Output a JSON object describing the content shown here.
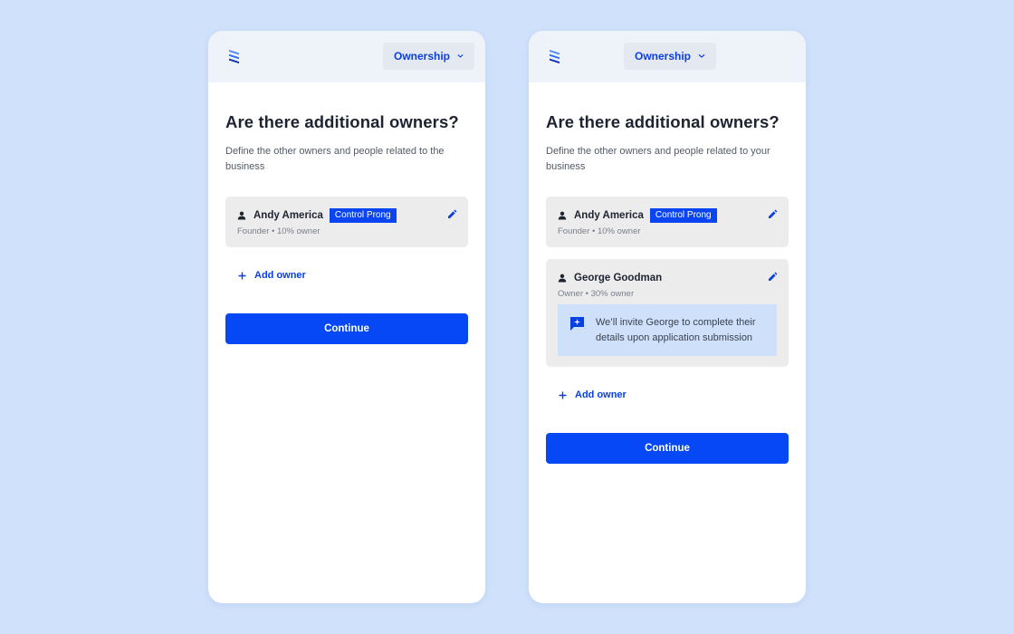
{
  "screens": [
    {
      "nav": {
        "dropdown_label": "Ownership"
      },
      "title": "Are there additional owners?",
      "subtitle": "Define the other owners and people related to the business",
      "owners": [
        {
          "name": "Andy America",
          "badge": "Control Prong",
          "meta": "Founder • 10% owner"
        }
      ],
      "add_owner_label": "Add owner",
      "continue_label": "Continue"
    },
    {
      "nav": {
        "dropdown_label": "Ownership"
      },
      "title": "Are there additional owners?",
      "subtitle": "Define the other owners and people related to your business",
      "owners": [
        {
          "name": "Andy America",
          "badge": "Control Prong",
          "meta": "Founder • 10% owner"
        },
        {
          "name": "George Goodman",
          "meta": "Owner • 30% owner",
          "notice": "We’ll invite George  to complete their details upon application submission"
        }
      ],
      "add_owner_label": "Add owner",
      "continue_label": "Continue"
    }
  ],
  "icons": {
    "logo": "stacked-stripes-logo",
    "dropdown": "chevron-down-icon",
    "person": "person-icon",
    "edit": "pencil-icon",
    "notice": "sparkle-message-icon",
    "add": "plus-icon"
  },
  "colors": {
    "background": "#cfe1fb",
    "accent": "#0648f6",
    "badge": "#0b45f2",
    "card": "#ececed",
    "notice": "#cfe0fb"
  }
}
